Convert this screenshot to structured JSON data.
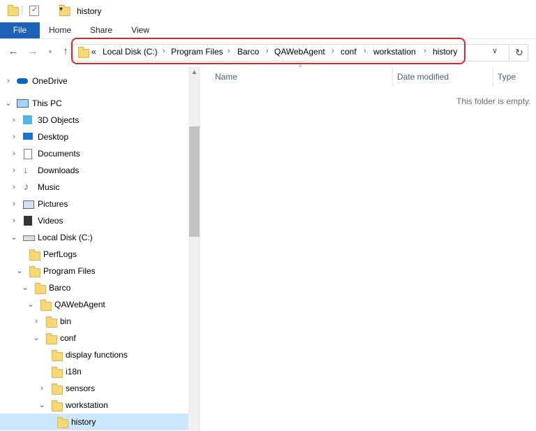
{
  "window": {
    "title": "history"
  },
  "ribbon": {
    "tabs": [
      "File",
      "Home",
      "Share",
      "View"
    ]
  },
  "address": {
    "overflow": "«",
    "crumbs": [
      "Local Disk (C:)",
      "Program Files",
      "Barco",
      "QAWebAgent",
      "conf",
      "workstation",
      "history"
    ]
  },
  "nav": {
    "items": [
      {
        "label": "OneDrive",
        "icon": "onedrive-icon"
      },
      {
        "label": "This PC",
        "icon": "this-pc-icon"
      },
      {
        "label": "3D Objects",
        "icon": "3d-objects-icon"
      },
      {
        "label": "Desktop",
        "icon": "desktop-icon"
      },
      {
        "label": "Documents",
        "icon": "documents-icon"
      },
      {
        "label": "Downloads",
        "icon": "downloads-icon"
      },
      {
        "label": "Music",
        "icon": "music-icon"
      },
      {
        "label": "Pictures",
        "icon": "pictures-icon"
      },
      {
        "label": "Videos",
        "icon": "videos-icon"
      },
      {
        "label": "Local Disk (C:)",
        "icon": "drive-icon"
      },
      {
        "label": "PerfLogs",
        "icon": "folder-icon"
      },
      {
        "label": "Program Files",
        "icon": "folder-icon"
      },
      {
        "label": "Barco",
        "icon": "folder-icon"
      },
      {
        "label": "QAWebAgent",
        "icon": "folder-icon"
      },
      {
        "label": "bin",
        "icon": "folder-icon"
      },
      {
        "label": "conf",
        "icon": "folder-icon"
      },
      {
        "label": "display functions",
        "icon": "folder-icon"
      },
      {
        "label": "i18n",
        "icon": "folder-icon"
      },
      {
        "label": "sensors",
        "icon": "folder-icon"
      },
      {
        "label": "workstation",
        "icon": "folder-icon"
      },
      {
        "label": "history",
        "icon": "folder-icon"
      }
    ]
  },
  "content": {
    "columns": [
      "Name",
      "Date modified",
      "Type"
    ],
    "empty_message": "This folder is empty."
  },
  "colors": {
    "file_tab": "#1c62b9",
    "selection": "#cce8ff",
    "highlight_border": "#e0262b",
    "folder": "#f8d775"
  }
}
